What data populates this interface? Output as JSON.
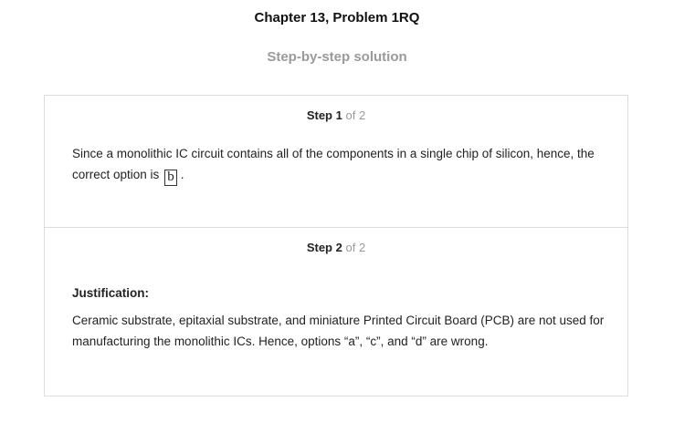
{
  "header": {
    "chapter_title": "Chapter 13, Problem 1RQ",
    "subtitle": "Step-by-step solution"
  },
  "steps": [
    {
      "step_word": "Step",
      "number": "1",
      "of_text": "of 2",
      "text_before": "Since a monolithic IC circuit contains all of the components in a single chip of silicon, hence, the correct option is",
      "answer": "b",
      "text_after": "."
    },
    {
      "step_word": "Step",
      "number": "2",
      "of_text": "of 2",
      "label": "Justification:",
      "text": "Ceramic substrate, epitaxial substrate, and miniature Printed Circuit Board (PCB) are not used for manufacturing the monolithic ICs. Hence, options “a”, “c”, and “d” are wrong."
    }
  ]
}
